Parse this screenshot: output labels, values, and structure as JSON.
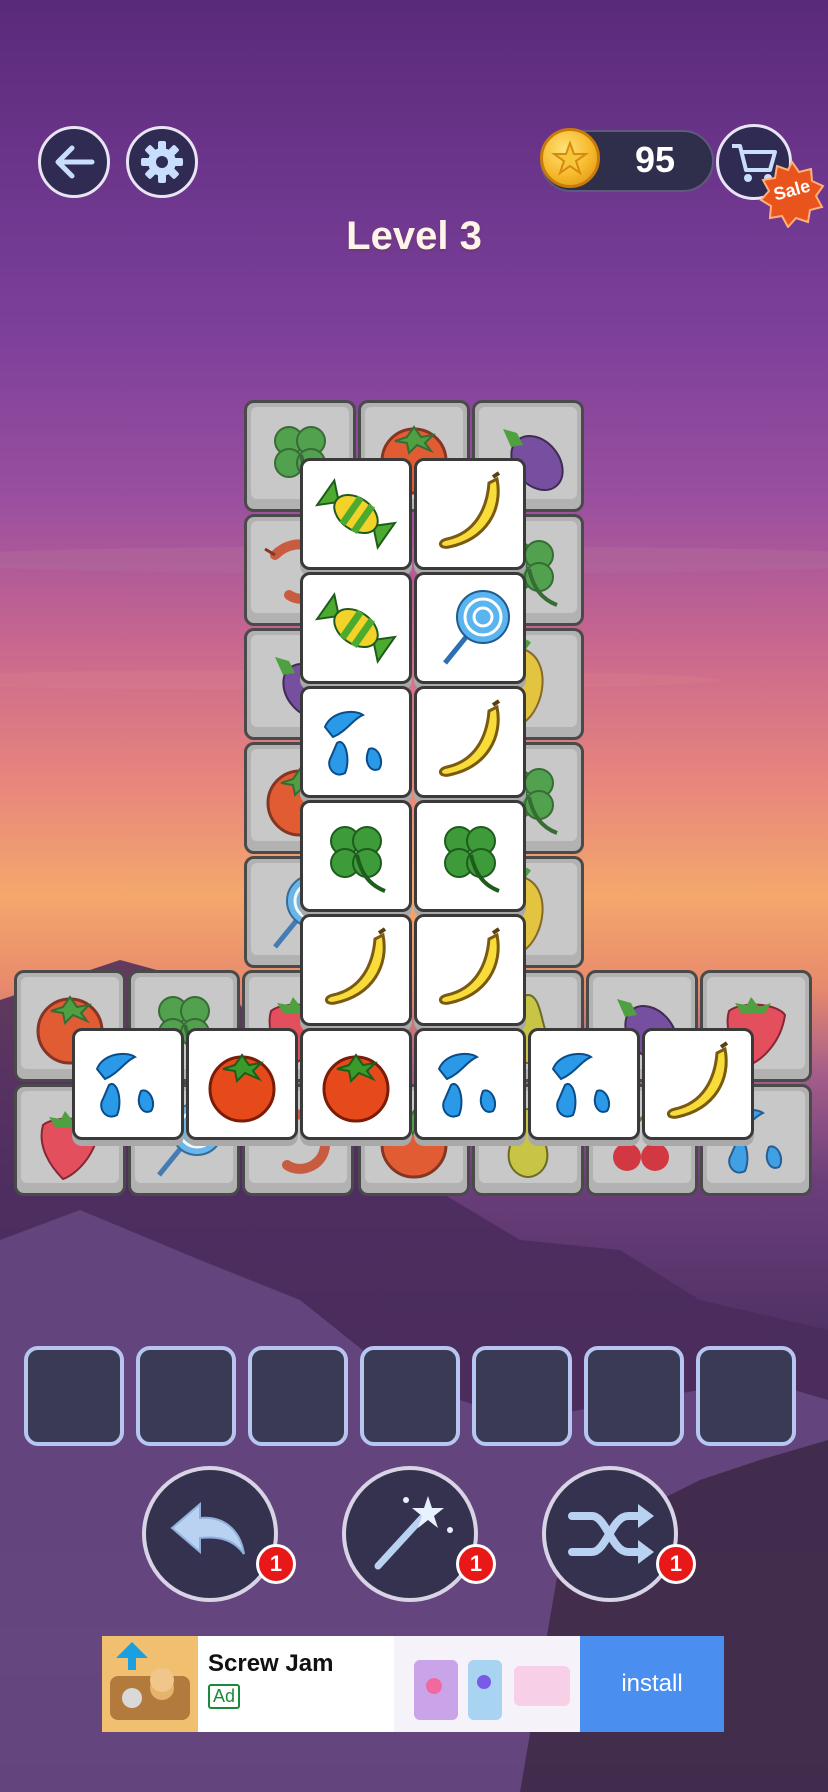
{
  "header": {
    "coins": "95",
    "sale_label": "Sale",
    "level_title": "Level 3"
  },
  "board": {
    "tile_count_front": 16,
    "tile_count_back": 24
  },
  "tray": {
    "slots": 7
  },
  "powerups": {
    "undo_count": "1",
    "magic_count": "1",
    "shuffle_count": "1"
  },
  "ad": {
    "title": "Screw Jam",
    "tag": "Ad",
    "cta": "install"
  },
  "colors": {
    "tile_front": "#ffffff",
    "tile_back": "#b2b2b2",
    "slot_border": "#b6c6f0",
    "badge": "#e81818",
    "install_button": "#4a8ff0"
  }
}
